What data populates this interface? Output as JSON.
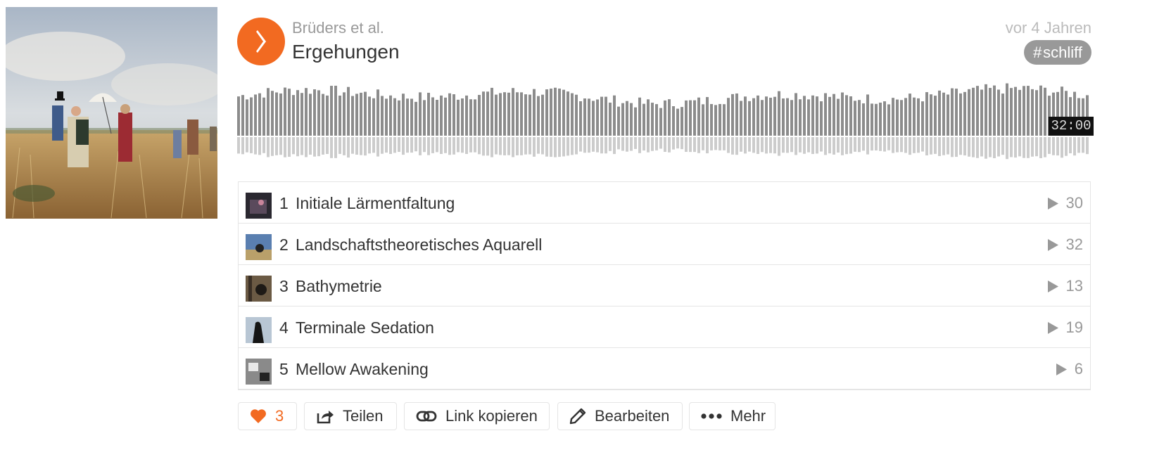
{
  "track": {
    "artist": "Brüders et al.",
    "title": "Ergehungen",
    "date": "vor 4 Jahren",
    "tag": "schliff",
    "duration": "32:00"
  },
  "tracklist": [
    {
      "num": "1",
      "name": "Initiale Lärmentfaltung",
      "plays": "30"
    },
    {
      "num": "2",
      "name": "Landschaftstheoretisches Aquarell",
      "plays": "32"
    },
    {
      "num": "3",
      "name": "Bathymetrie",
      "plays": "13"
    },
    {
      "num": "4",
      "name": "Terminale Sedation",
      "plays": "19"
    },
    {
      "num": "5",
      "name": "Mellow Awakening",
      "plays": "6"
    }
  ],
  "actions": {
    "like_count": "3",
    "share": "Teilen",
    "copy_link": "Link kopieren",
    "edit": "Bearbeiten",
    "more": "Mehr"
  },
  "colors": {
    "accent": "#f26a21",
    "waveform": "#8c8c8c",
    "waveform_reflection": "#cccccc"
  },
  "icons": [
    "play-icon",
    "heart-icon",
    "share-icon",
    "link-icon",
    "pencil-icon",
    "more-icon"
  ]
}
